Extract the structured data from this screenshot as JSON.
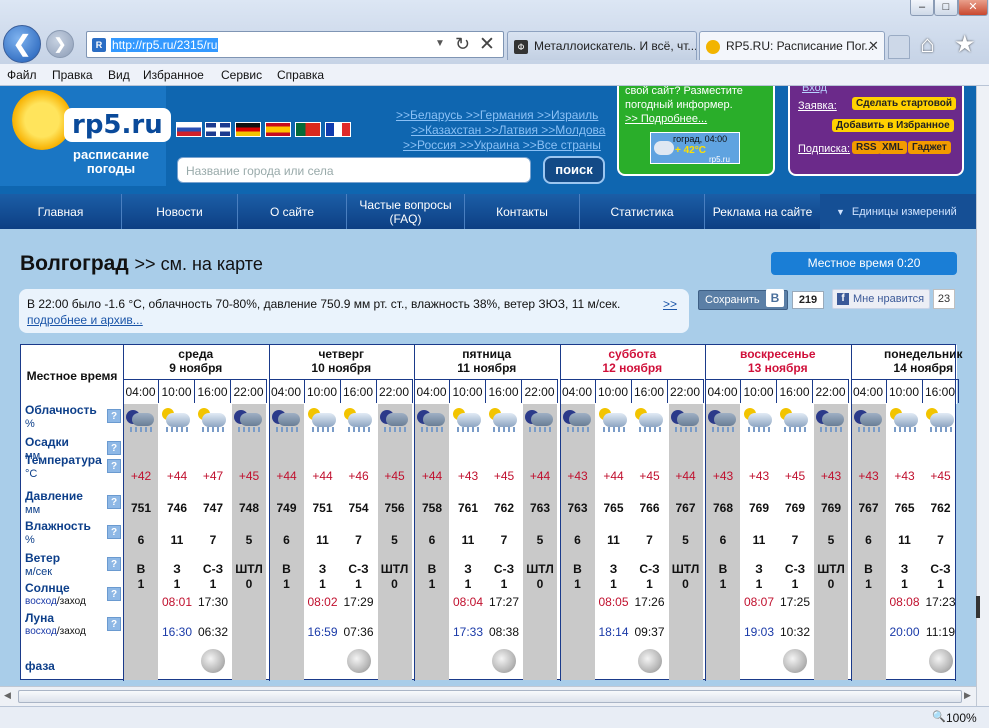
{
  "browser": {
    "address_url": "http://rp5.ru/2315/ru",
    "tabs": [
      {
        "label": "Металлоискатель. И всё, чт...",
        "active": false
      },
      {
        "label": "RP5.RU: Расписание Пог...",
        "active": true
      }
    ],
    "menu": [
      "Файл",
      "Правка",
      "Вид",
      "Избранное",
      "Сервис",
      "Справка"
    ],
    "zoom": "100%",
    "window_buttons": [
      "–",
      "□",
      "✕"
    ]
  },
  "header": {
    "logo_main": "rp5.ru",
    "logo_sub": "расписание погоды",
    "search_placeholder": "Название города или села",
    "search_button": "поиск",
    "country_links": [
      ">>Беларусь >>Германия >>Израиль",
      ">>Казахстан >>Латвия >>Молдова",
      ">>Россия >>Украина >>Все страны"
    ],
    "informer": {
      "line1": "свой сайт? Разместите",
      "line2": "погодный информер.",
      "more": ">> Подробнее...",
      "mini_city": "гоград, 04:00",
      "mini_temp": "+ 42°C",
      "mini_site": "rp5.ru"
    },
    "settings": {
      "top_link": "Вход",
      "request_label": "Заявка:",
      "start_page": "Сделать стартовой",
      "favorites": "Добавить в Избранное",
      "subscribe_label": "Подписка:",
      "rss": "RSS",
      "xml": "XML",
      "gadget": "Гаджет"
    }
  },
  "nav": {
    "items": [
      "Главная",
      "Новости",
      "О сайте",
      "Частые вопросы (FAQ)",
      "Контакты",
      "Статистика",
      "Реклама на сайте"
    ],
    "units": "Единицы измерений"
  },
  "city": {
    "name": "Волгоград",
    "map_link": ">> см. на карте",
    "local_time": "Местное время  0:20"
  },
  "observation": {
    "text": "В 22:00 было -1.6 °C,  облачность 70-80%,   давление 750.9 мм рт. ст.,    влажность 38%, ветер ЗЮЗ, 11 м/сек.",
    "more": ">>",
    "more2": "подробнее и архив..."
  },
  "social": {
    "save": "Сохранить",
    "vk": "B",
    "vk_count": "219",
    "fb": "Мне нравится",
    "fb_count": "23"
  },
  "forecast": {
    "local_time_label": "Местное время",
    "days": [
      {
        "weekday": "среда",
        "date": "9 ноября",
        "weekend": false
      },
      {
        "weekday": "четверг",
        "date": "10 ноября",
        "weekend": false
      },
      {
        "weekday": "пятница",
        "date": "11 ноября",
        "weekend": false
      },
      {
        "weekday": "суббота",
        "date": "12 ноября",
        "weekend": true
      },
      {
        "weekday": "воскресенье",
        "date": "13 ноября",
        "weekend": true
      },
      {
        "weekday": "понедельник",
        "date": "14 ноября",
        "weekend": false
      }
    ],
    "hours": [
      "04:00",
      "10:00",
      "16:00",
      "22:00",
      "04:00",
      "10:00",
      "16:00",
      "22:00",
      "04:00",
      "10:00",
      "16:00",
      "22:00",
      "04:00",
      "10:00",
      "16:00",
      "22:00",
      "04:00",
      "10:00",
      "16:00",
      "22:00",
      "04:00",
      "10:00",
      "16:00"
    ],
    "rows": {
      "cloud": {
        "label": "Облачность",
        "unit": "%"
      },
      "precip": {
        "label": "Осадки",
        "unit": "мм"
      },
      "temp": {
        "label": "Температура",
        "unit": "°C",
        "values": [
          "+42",
          "+44",
          "+47",
          "+45",
          "+44",
          "+44",
          "+46",
          "+45",
          "+44",
          "+43",
          "+45",
          "+44",
          "+43",
          "+44",
          "+45",
          "+44",
          "+43",
          "+43",
          "+45",
          "+43",
          "+43",
          "+43",
          "+45"
        ]
      },
      "pressure": {
        "label": "Давление",
        "unit": "мм",
        "values": [
          "751",
          "746",
          "747",
          "748",
          "749",
          "751",
          "754",
          "756",
          "758",
          "761",
          "762",
          "763",
          "763",
          "765",
          "766",
          "767",
          "768",
          "769",
          "769",
          "769",
          "767",
          "765",
          "762"
        ]
      },
      "humidity": {
        "label": "Влажность",
        "unit": "%",
        "values": [
          "6",
          "11",
          "7",
          "5",
          "6",
          "11",
          "7",
          "5",
          "6",
          "11",
          "7",
          "5",
          "6",
          "11",
          "7",
          "5",
          "6",
          "11",
          "7",
          "5",
          "6",
          "11",
          "7"
        ]
      },
      "wind": {
        "label": "Ветер",
        "unit": "м/сек",
        "dir": [
          "В",
          "З",
          "С-З",
          "ШТЛ",
          "В",
          "З",
          "С-З",
          "ШТЛ",
          "В",
          "З",
          "С-З",
          "ШТЛ",
          "В",
          "З",
          "С-З",
          "ШТЛ",
          "В",
          "З",
          "С-З",
          "ШТЛ",
          "В",
          "З",
          "С-З"
        ],
        "speed": [
          "1",
          "1",
          "1",
          "0",
          "1",
          "1",
          "1",
          "0",
          "1",
          "1",
          "1",
          "0",
          "1",
          "1",
          "1",
          "0",
          "1",
          "1",
          "1",
          "0",
          "1",
          "1",
          "1"
        ]
      },
      "sun": {
        "label": "Солнце",
        "sub1": "восход",
        "sub2": "/заход",
        "values": [
          [
            "08:01",
            "17:30"
          ],
          [
            "08:02",
            "17:29"
          ],
          [
            "08:04",
            "17:27"
          ],
          [
            "08:05",
            "17:26"
          ],
          [
            "08:07",
            "17:25"
          ],
          [
            "08:08",
            "17:23"
          ]
        ]
      },
      "moon": {
        "label": "Луна",
        "sub1": "восход",
        "sub2": "/заход",
        "values": [
          [
            "16:30",
            "06:32"
          ],
          [
            "16:59",
            "07:36"
          ],
          [
            "17:33",
            "08:38"
          ],
          [
            "18:14",
            "09:37"
          ],
          [
            "19:03",
            "10:32"
          ],
          [
            "20:00",
            "11:19"
          ]
        ]
      },
      "phase": {
        "label": "фаза"
      }
    },
    "help": "?"
  },
  "colors": {
    "weekend": "#d0103a",
    "temp": "#c0102e",
    "moonrise": "#1a3aa8",
    "label": "#0d3f8a"
  }
}
